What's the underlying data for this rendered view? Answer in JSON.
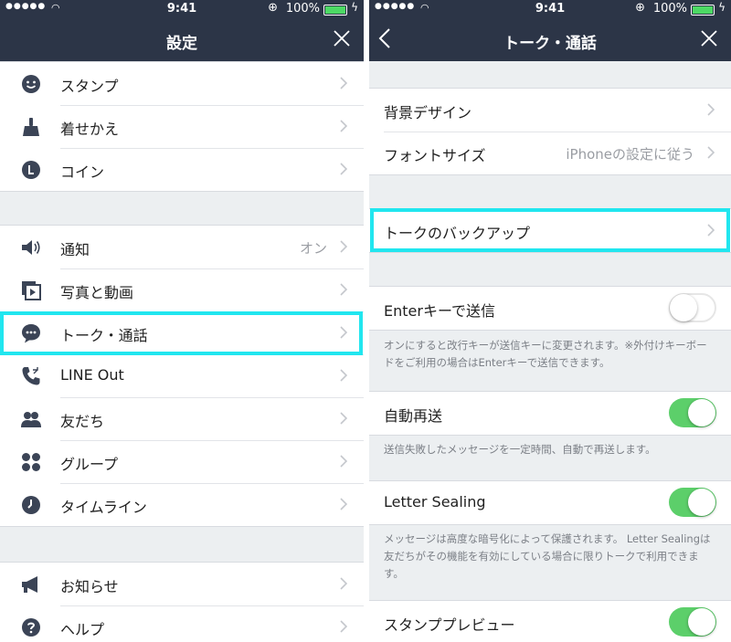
{
  "status_bar": {
    "time": "9:41",
    "battery": "100%",
    "signal_dots": "●●●●●"
  },
  "settings": {
    "title": "設定",
    "group1": [
      {
        "label": "スタンプ",
        "icon": "smiley-icon"
      },
      {
        "label": "着せかえ",
        "icon": "brush-icon"
      },
      {
        "label": "コイン",
        "icon": "coin-icon"
      }
    ],
    "group2": [
      {
        "label": "通知",
        "value": "オン",
        "icon": "speaker-icon"
      },
      {
        "label": "写真と動画",
        "icon": "photo-video-icon"
      },
      {
        "label": "トーク・通話",
        "icon": "chat-bubble-icon",
        "highlighted": true
      },
      {
        "label": "LINE Out",
        "icon": "phone-out-icon"
      },
      {
        "label": "友だち",
        "icon": "friends-icon"
      },
      {
        "label": "グループ",
        "icon": "group-icon"
      },
      {
        "label": "タイムライン",
        "icon": "clock-icon"
      }
    ],
    "group3": [
      {
        "label": "お知らせ",
        "icon": "megaphone-icon"
      },
      {
        "label": "ヘルプ",
        "icon": "help-icon"
      }
    ]
  },
  "talk": {
    "title": "トーク・通話",
    "background_design": "背景デザイン",
    "font_size": "フォントサイズ",
    "font_size_value": "iPhoneの設定に従う",
    "backup": "トークのバックアップ",
    "enter_send": {
      "label": "Enterキーで送信",
      "on": false,
      "note": "オンにすると改行キーが送信キーに変更されます。※外付けキーボードをご利用の場合はEnterキーで送信できます。"
    },
    "auto_resend": {
      "label": "自動再送",
      "on": true,
      "note": "送信失敗したメッセージを一定時間、自動で再送します。"
    },
    "letter_sealing": {
      "label": "Letter Sealing",
      "on": true,
      "note": "メッセージは高度な暗号化によって保護されます。 Letter Sealingは友だちがその機能を有効にしている場合に限りトークで利用できます。"
    },
    "sticker_preview": {
      "label": "スタンププレビュー",
      "on": true
    }
  },
  "colors": {
    "nav_bg": "#2c3547",
    "toggle_on": "#5ccf6a",
    "highlight": "#21e6ef",
    "icon": "#3b4456"
  }
}
